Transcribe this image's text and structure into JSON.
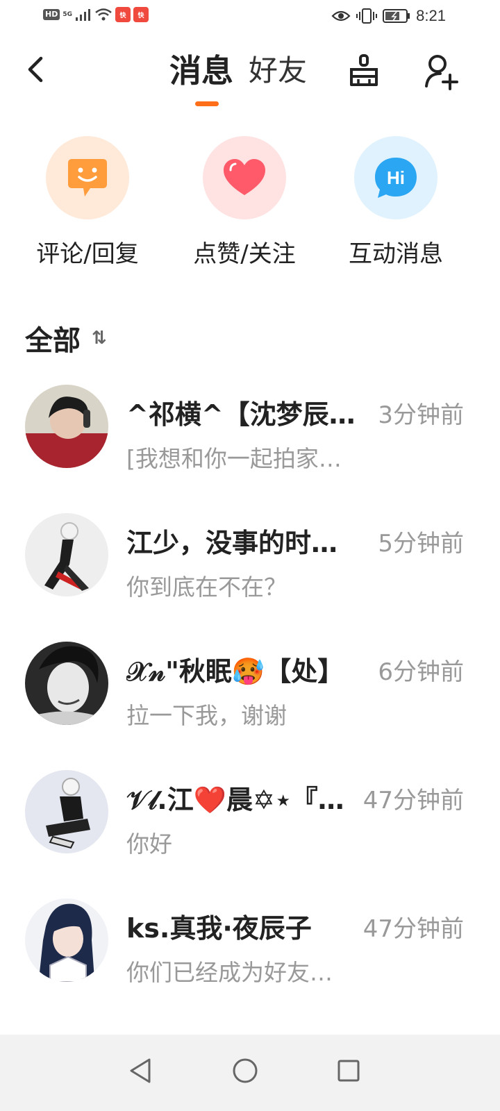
{
  "status_bar": {
    "hd": "HD",
    "network": "5G",
    "app_badge": "快",
    "time": "8:21"
  },
  "header": {
    "tab_messages": "消息",
    "tab_friends": "好友",
    "accent_color": "#ff6f1a"
  },
  "categories": [
    {
      "label": "评论/回复",
      "icon": "smile-chat-icon",
      "bg": "#ffe9d9",
      "fg": "#ff9c3c"
    },
    {
      "label": "点赞/关注",
      "icon": "heart-icon",
      "bg": "#ffe3e3",
      "fg": "#ff5a6a"
    },
    {
      "label": "互动消息",
      "icon": "hi-bubble-icon",
      "bg": "#dff2fd",
      "fg": "#2ba6f2",
      "icon_text": "Hi"
    }
  ],
  "section": {
    "title": "全部",
    "sort_icon": "⇅"
  },
  "messages": [
    {
      "name": "^祁横^【沈梦辰…",
      "time": "3分钟前",
      "preview": "[我想和你一起拍家…"
    },
    {
      "name": "江少，没事的时…",
      "time": "5分钟前",
      "preview": "你到底在不在？"
    },
    {
      "name": "𝒳𝓃\"秋眠🥵【处】",
      "time": "6分钟前",
      "preview": "拉一下我，谢谢"
    },
    {
      "name": "𝒱𝓁.江❤️晨✡⋆『…",
      "time": "47分钟前",
      "preview": "你好"
    },
    {
      "name": "ks.真我·夜辰子",
      "time": "47分钟前",
      "preview": "你们已经成为好友…"
    }
  ]
}
